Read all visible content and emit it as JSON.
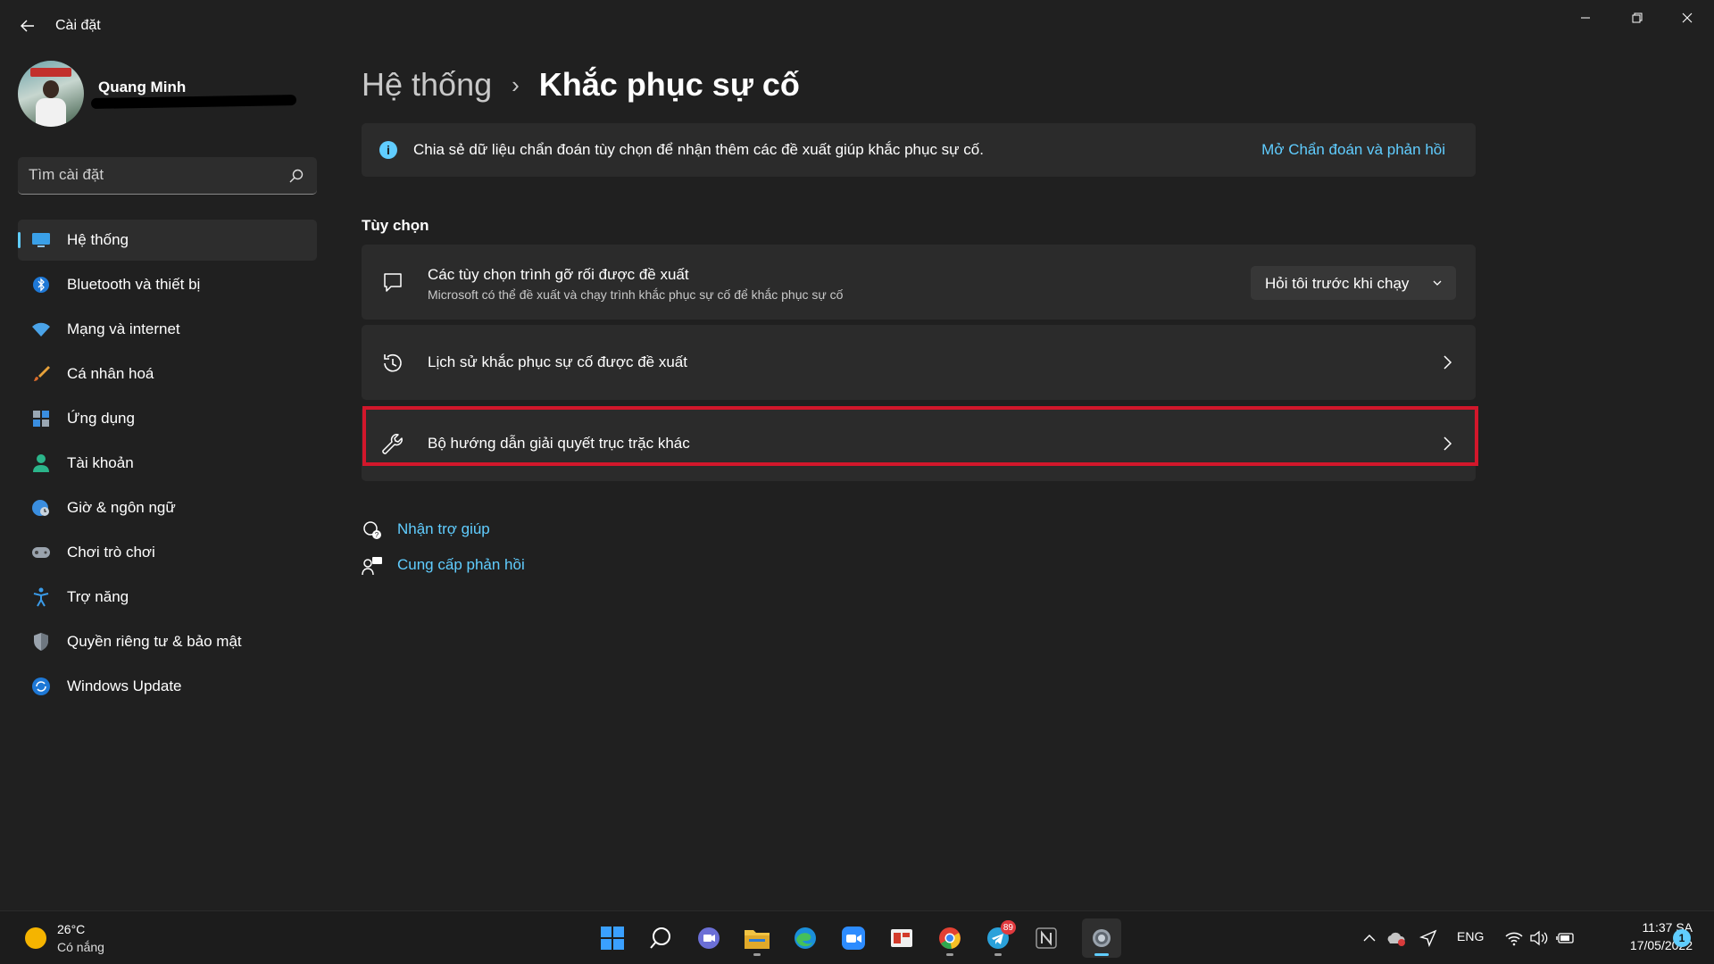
{
  "window": {
    "title": "Cài đặt",
    "controls": [
      "minimize",
      "restore",
      "close"
    ]
  },
  "profile": {
    "name": "Quang Minh"
  },
  "search": {
    "placeholder": "Tìm cài đặt"
  },
  "sidebar": {
    "items": [
      {
        "label": "Hệ thống",
        "icon": "system-icon",
        "active": true
      },
      {
        "label": "Bluetooth và thiết bị",
        "icon": "bluetooth-icon"
      },
      {
        "label": "Mạng và internet",
        "icon": "wifi-icon"
      },
      {
        "label": "Cá nhân hoá",
        "icon": "brush-icon"
      },
      {
        "label": "Ứng dụng",
        "icon": "apps-icon"
      },
      {
        "label": "Tài khoản",
        "icon": "account-icon"
      },
      {
        "label": "Giờ & ngôn ngữ",
        "icon": "globe-clock-icon"
      },
      {
        "label": "Chơi trò chơi",
        "icon": "gamepad-icon"
      },
      {
        "label": "Trợ năng",
        "icon": "accessibility-icon"
      },
      {
        "label": "Quyền riêng tư & bảo mật",
        "icon": "shield-icon"
      },
      {
        "label": "Windows Update",
        "icon": "update-icon"
      }
    ]
  },
  "breadcrumb": {
    "parent": "Hệ thống",
    "separator": "›",
    "current": "Khắc phục sự cố"
  },
  "info_bar": {
    "text": "Chia sẻ dữ liệu chẩn đoán tùy chọn để nhận thêm các đề xuất giúp khắc phục sự cố.",
    "link": "Mở Chẩn đoán và phản hồi"
  },
  "options": {
    "title": "Tùy chọn",
    "recommended": {
      "title": "Các tùy chọn trình gỡ rối được đề xuất",
      "subtitle": "Microsoft có thể đề xuất và chạy trình khắc phục sự cố để khắc phục sự cố",
      "dropdown_value": "Hỏi tôi trước khi chạy"
    },
    "history": {
      "title": "Lịch sử khắc phục sự cố được đề xuất"
    },
    "other": {
      "title": "Bộ hướng dẫn giải quyết trục trặc khác"
    }
  },
  "links": {
    "help": "Nhận trợ giúp",
    "feedback": "Cung cấp phản hồi"
  },
  "taskbar": {
    "weather_temp": "26°C",
    "weather_desc": "Có nắng",
    "telegram_badge": "89",
    "language": "ENG",
    "time": "11:37 SA",
    "date": "17/05/2022",
    "notification_count": "1"
  },
  "colors": {
    "accent": "#60cdff",
    "highlight_border": "#d2172b",
    "background": "#202020",
    "card": "#2b2b2b"
  }
}
